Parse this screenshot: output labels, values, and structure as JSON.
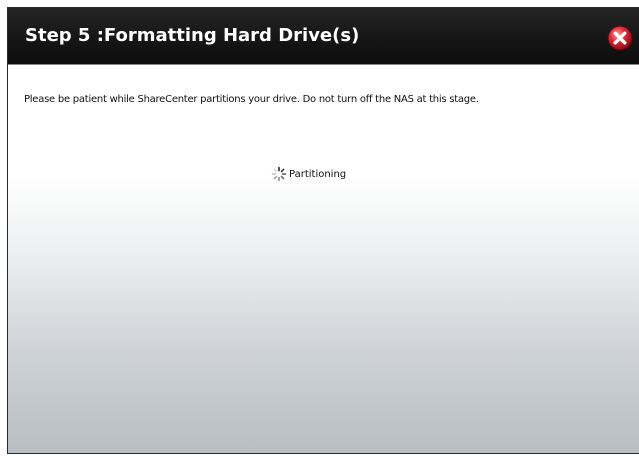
{
  "dialog": {
    "title": "Step 5 :Formatting Hard Drive(s)",
    "close_icon": "close-icon",
    "message": "Please be patient while ShareCenter partitions your drive. Do not turn off the NAS at this stage.",
    "status": {
      "icon": "loading-spinner-icon",
      "text": "Partitioning"
    }
  },
  "colors": {
    "titlebar": "#161616",
    "title_text": "#ffffff",
    "close_button": "#c8102e"
  }
}
